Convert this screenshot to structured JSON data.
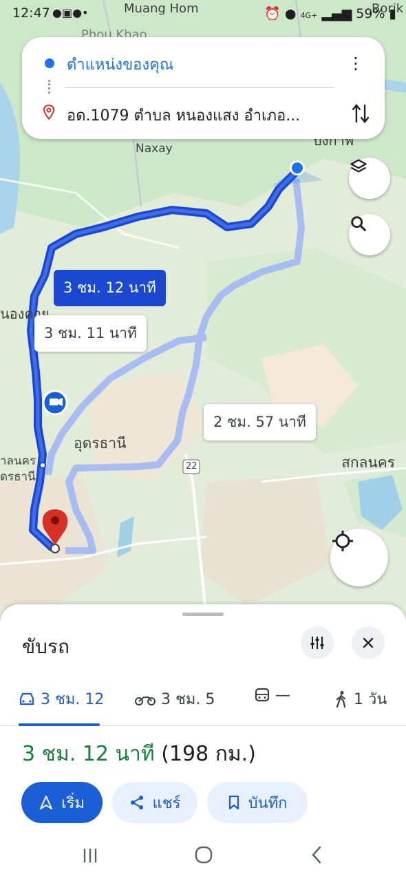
{
  "status_bar": {
    "time": "12:47",
    "battery": "59%",
    "network": "4G+"
  },
  "map": {
    "place_labels": {
      "muang_hom": "Muang Hom",
      "boriKhan": "Borik",
      "phou_khao": "Phou Khao",
      "naxay": "Naxay",
      "nong_khai": "นองคาย",
      "udon_thani": "อุดรธานี",
      "sakon_nakhon": "สกลนคร",
      "left_edge_1": "าลนคร",
      "left_edge_2": "ดรธานี",
      "top_right_partial": "บงกาฬ",
      "road_22": "22"
    },
    "route_labels": {
      "primary": "3 ชม. 12 นาที",
      "alt1": "3 ชม. 11 นาที",
      "alt2": "2 ชม. 57 นาที"
    },
    "colors": {
      "primary_route": "#1a48d1",
      "alt_route": "#a7bdf2",
      "destination_pin": "#d93025"
    }
  },
  "search": {
    "from": "ตำแหน่งของคุณ",
    "to": "อด.1079 ตำบล หนองแสง อำเภอ..."
  },
  "sheet": {
    "mode_title": "ขับรถ",
    "tabs": [
      {
        "label": "3 ชม. 12",
        "icon": "car-icon",
        "active": true
      },
      {
        "label": "3 ชม. 5",
        "icon": "motorcycle-icon",
        "active": false
      },
      {
        "label": "—",
        "icon": "transit-icon",
        "active": false
      },
      {
        "label": "1 วัน",
        "icon": "walk-icon",
        "active": false
      }
    ],
    "summary_time": "3 ชม. 12 นาที",
    "summary_distance": "(198 กม.)",
    "actions": {
      "start": "เริ่ม",
      "share": "แชร์",
      "save": "บันทึก"
    }
  }
}
